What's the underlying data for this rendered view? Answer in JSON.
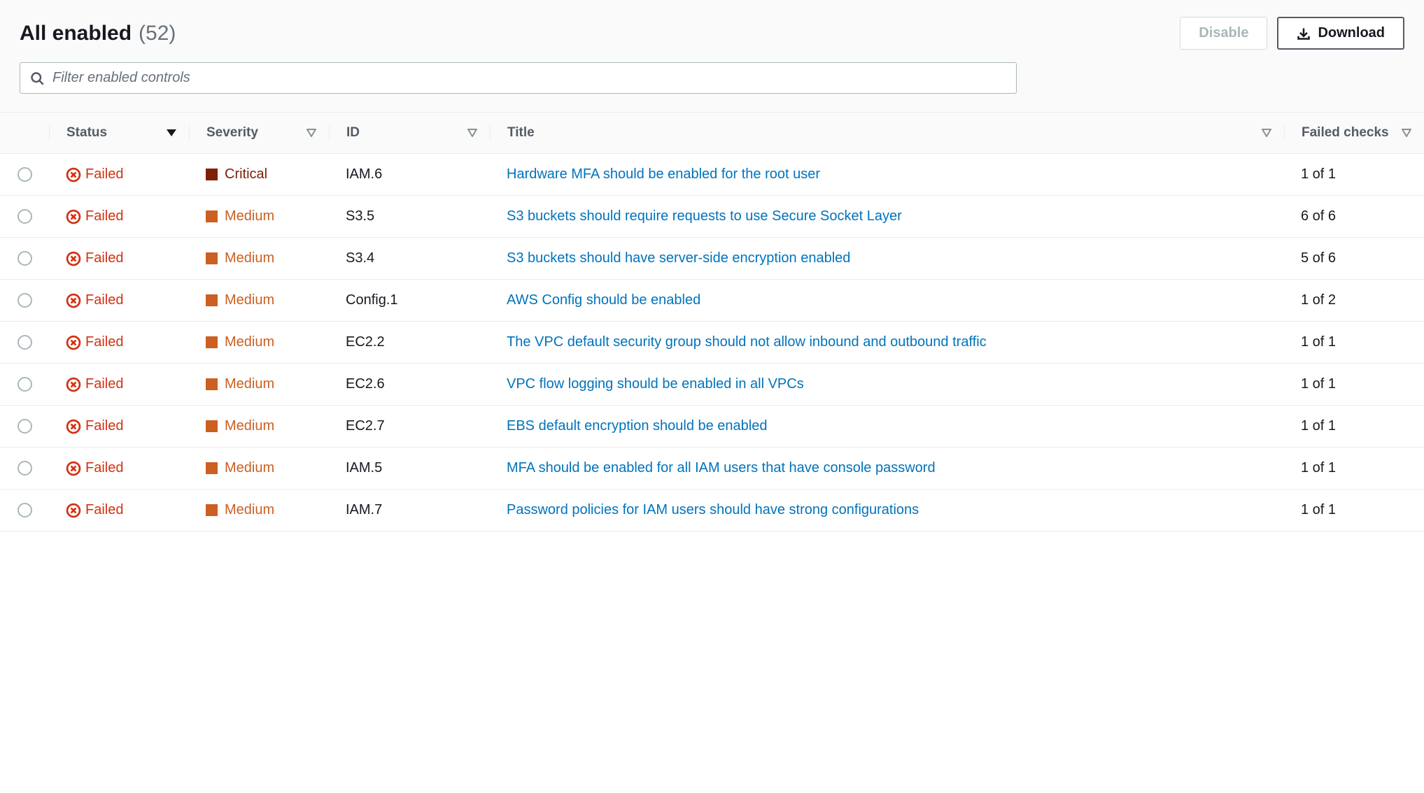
{
  "header": {
    "title": "All enabled",
    "count": "(52)",
    "disable_label": "Disable",
    "download_label": "Download"
  },
  "filter": {
    "placeholder": "Filter enabled controls"
  },
  "columns": {
    "status": "Status",
    "severity": "Severity",
    "id": "ID",
    "title": "Title",
    "failed_checks": "Failed checks"
  },
  "severity_labels": {
    "critical": "Critical",
    "medium": "Medium"
  },
  "status_labels": {
    "failed": "Failed"
  },
  "rows": [
    {
      "status": "failed",
      "severity": "critical",
      "id": "IAM.6",
      "title": "Hardware MFA should be enabled for the root user",
      "checks": "1 of 1"
    },
    {
      "status": "failed",
      "severity": "medium",
      "id": "S3.5",
      "title": "S3 buckets should require requests to use Secure Socket Layer",
      "checks": "6 of 6"
    },
    {
      "status": "failed",
      "severity": "medium",
      "id": "S3.4",
      "title": "S3 buckets should have server-side encryption enabled",
      "checks": "5 of 6"
    },
    {
      "status": "failed",
      "severity": "medium",
      "id": "Config.1",
      "title": "AWS Config should be enabled",
      "checks": "1 of 2"
    },
    {
      "status": "failed",
      "severity": "medium",
      "id": "EC2.2",
      "title": "The VPC default security group should not allow inbound and outbound traffic",
      "checks": "1 of 1"
    },
    {
      "status": "failed",
      "severity": "medium",
      "id": "EC2.6",
      "title": "VPC flow logging should be enabled in all VPCs",
      "checks": "1 of 1"
    },
    {
      "status": "failed",
      "severity": "medium",
      "id": "EC2.7",
      "title": "EBS default encryption should be enabled",
      "checks": "1 of 1"
    },
    {
      "status": "failed",
      "severity": "medium",
      "id": "IAM.5",
      "title": "MFA should be enabled for all IAM users that have console password",
      "checks": "1 of 1"
    },
    {
      "status": "failed",
      "severity": "medium",
      "id": "IAM.7",
      "title": "Password policies for IAM users should have strong configurations",
      "checks": "1 of 1"
    }
  ]
}
